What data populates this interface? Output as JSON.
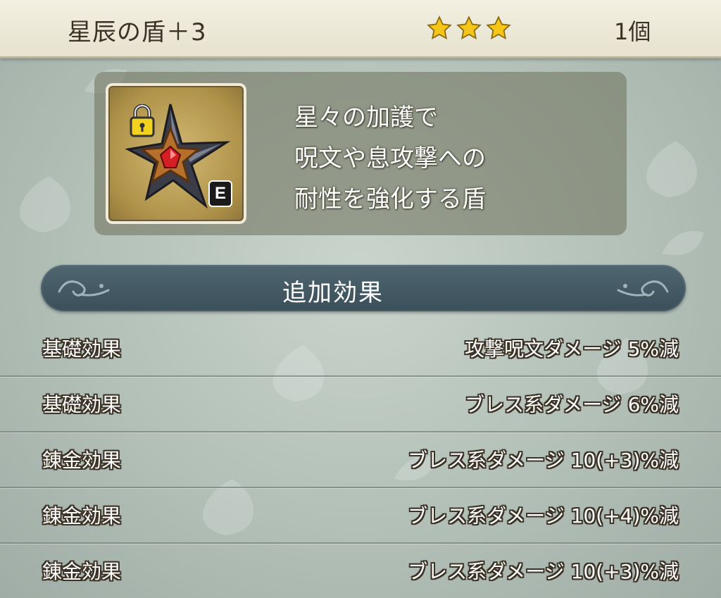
{
  "header": {
    "item_name": "星辰の盾＋3",
    "star_count": 3,
    "star_color": "#f5c518",
    "count": "1個"
  },
  "item": {
    "icon": "star-shield-icon",
    "lock_icon": "lock-icon",
    "equipped_badge": "E",
    "description": [
      "星々の加護で",
      "呪文や息攻撃への",
      "耐性を強化する盾"
    ]
  },
  "section": {
    "title": "追加効果"
  },
  "effects": [
    {
      "label": "基礎効果",
      "value": "攻撃呪文ダメージ 5%減"
    },
    {
      "label": "基礎効果",
      "value": "ブレス系ダメージ 6%減"
    },
    {
      "label": "錬金効果",
      "value": "ブレス系ダメージ 10(+3)%減"
    },
    {
      "label": "錬金効果",
      "value": "ブレス系ダメージ 10(+4)%減"
    },
    {
      "label": "錬金効果",
      "value": "ブレス系ダメージ 10(+3)%減"
    }
  ]
}
